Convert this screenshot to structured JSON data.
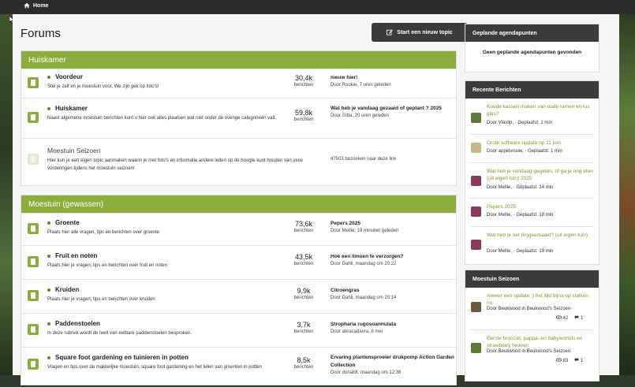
{
  "topbar": {
    "home_label": "Home"
  },
  "page": {
    "title": "Forums",
    "new_topic_label": "Start een nieuw topic"
  },
  "categories": [
    {
      "name": "Huiskamer",
      "forums": [
        {
          "name": "Voordeur",
          "desc": "Stel je zelf en je moestuin voor. We zijn gek op foto's!",
          "count": "30,4k",
          "count_label": "berichten",
          "last_title": "nieuw hier!",
          "last_by": "Door Rookie, 7 uren geleden"
        },
        {
          "name": "Huiskamer",
          "desc": "Naast algemene moestuin berichten kunt u hier ook alles plaatsen wat niet onder de overige categorieën valt.",
          "count": "59,8k",
          "count_label": "berichten",
          "last_title": "Wat heb je vandaag gezaaid of geplant ? 2025",
          "last_by": "Door Gitta, 20 uren geleden"
        },
        {
          "name": "Moestuin Seizoen",
          "desc": "Hier kun je een eigen topic aanmaken waarin je met foto's en informatie andere leden op de hoogte kunt houden van jouw vorderingen tijdens het moestuin seizoen!",
          "visits": "47503 bezoeken naar deze link"
        }
      ]
    },
    {
      "name": "Moestuin (gewassen)",
      "forums": [
        {
          "name": "Groente",
          "desc": "Plaats hier alle vragen, tips en berichten over groente",
          "count": "73,6k",
          "count_label": "berichten",
          "last_title": "Pepers 2025",
          "last_by": "Door Mellie, 19 minuten geleden"
        },
        {
          "name": "Fruit en noten",
          "desc": "Plaats hier je vragen, tips en berichten over fruit en noten",
          "count": "43,5k",
          "count_label": "berichten",
          "last_title": "Hoe een limoen te verzorgen?",
          "last_by": "Door Dahli, maandag om 20:22"
        },
        {
          "name": "Kruiden",
          "desc": "Plaats hier je vragen, tips en berichten over kruiden",
          "count": "9,9k",
          "count_label": "berichten",
          "last_title": "Citroengras",
          "last_by": "Door Dahli, maandag om 20:14"
        },
        {
          "name": "Paddenstoelen",
          "desc": "In deze rubriek wordt de teelt van eetbare paddenstoelen besproken.",
          "count": "3,7k",
          "count_label": "berichten",
          "last_title": "Stropharia rugosoannulata",
          "last_by": "Door abracadavra, 8 mei"
        },
        {
          "name": "Square foot gardening en tuinieren in potten",
          "desc": "Vragen en tips over de makkelijke moestuin, square foot gardening en het telen van groenten in potten",
          "count": "8,5k",
          "count_label": "berichten",
          "last_title": "Ervaring plantensproeier drukpomp Action Garden Collection",
          "last_by": "Door donaldt, maandag om 12:38"
        }
      ]
    }
  ],
  "sidebar": {
    "agenda": {
      "title": "Geplande agendapunten",
      "empty": "Geen geplande agendapunten gevonden"
    },
    "recent": {
      "title": "Recente Berichten",
      "posts": [
        {
          "title": "Koude kassen maken van oude ramen en los glas?",
          "meta": "Door Vlavlip, · Geplaatst: 1 min",
          "thumb_color": "#5d7a3a"
        },
        {
          "title": "Grote software update op 11 juni",
          "meta": "Door appelvrouw, · Geplaatst: 1 min",
          "thumb_color": "#c9b98a"
        },
        {
          "title": "Wat heb je vandaag gegeten, of ga je nog eten (uit eigen tuin) 2025",
          "meta": "Door Mellie, · Geplaatst: 14 min",
          "thumb_color": "#8a3a5a"
        },
        {
          "title": "Pepers 2025",
          "meta": "Door Mellie, · Geplaatst: 18 min",
          "thumb_color": "#8a3a5a"
        },
        {
          "title": "Wat heb je net (in)geemaakt? (uit eigen tuin)",
          "meta": "Door Mellie, · Geplaatst: 19 min",
          "thumb_color": "#8a3a5a"
        }
      ]
    },
    "season": {
      "title": "Moestuin Seizoen",
      "posts": [
        {
          "title": "Alweer een update ;) het lijkt bijna op stalken nu",
          "meta": "Door Beukwood in Beukwood's Seizoen",
          "views": "42",
          "replies": "1",
          "thumb_color": "#6a5a3a"
        },
        {
          "title": "Eerste broccoli, pappa- en babywortels en strawberry heaven",
          "meta": "Door Beukwood in Beukwood's Seizoen",
          "views": "83",
          "replies": "1",
          "thumb_color": "#5a7a3a"
        }
      ]
    }
  }
}
